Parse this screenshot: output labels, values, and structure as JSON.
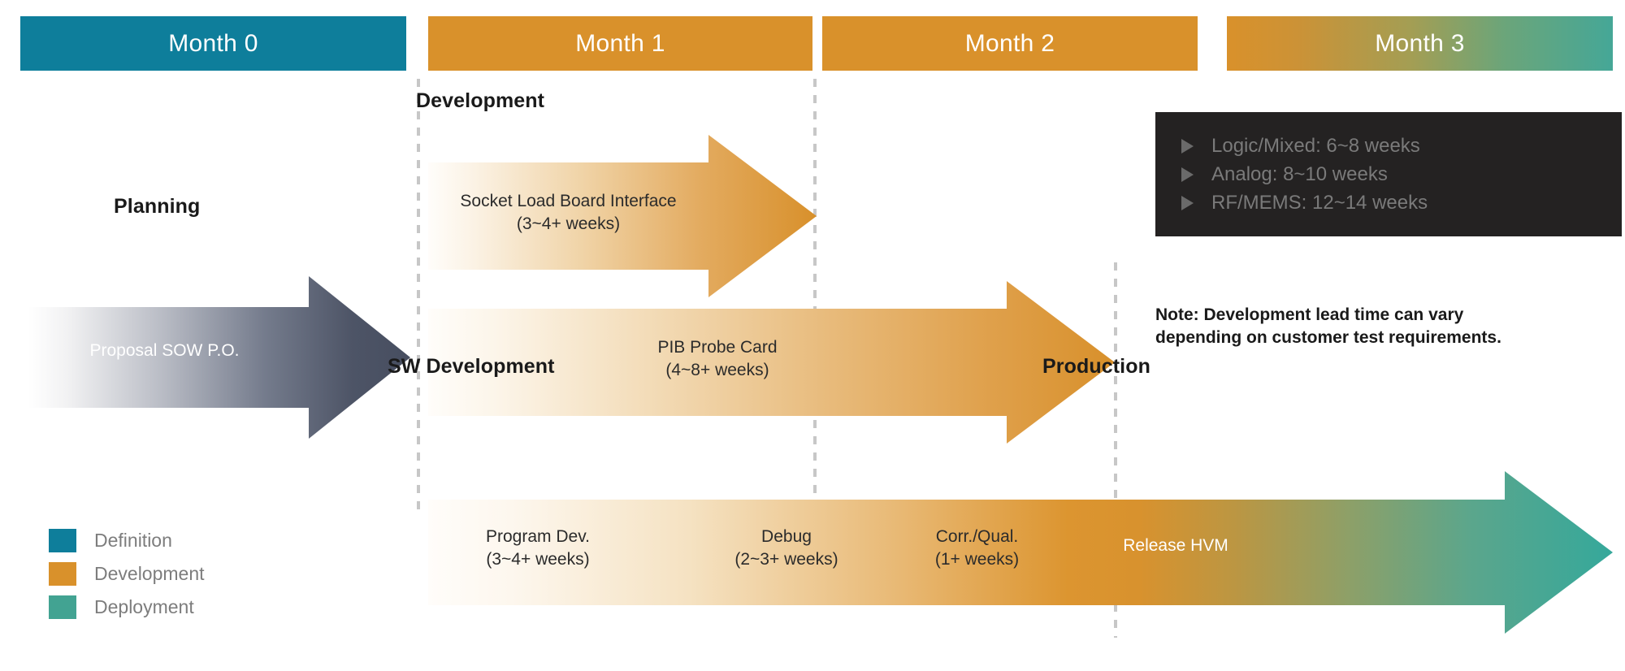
{
  "timeline": {
    "months": [
      {
        "label": "Month 0",
        "color": "#0E7E9B"
      },
      {
        "label": "Month 1",
        "color": "#D9912B"
      },
      {
        "label": "Month 2",
        "color": "#D9912B"
      },
      {
        "label": "Month 3",
        "color": "#D9912B"
      }
    ]
  },
  "phases": {
    "planning": "Planning",
    "development": "Development",
    "sw_development": "SW Development",
    "production": "Production"
  },
  "tracks": [
    {
      "name": "planning",
      "label": "Proposal SOW P.O.",
      "caption": "Planning"
    },
    {
      "name": "socket-load-board",
      "label": "Socket Load Board Interface\n(3~4+ weeks)",
      "caption": "Development"
    },
    {
      "name": "pib-probe-card",
      "label": "PIB Probe Card\n(4~8+ weeks)"
    },
    {
      "name": "sw-development",
      "caption": "SW Development",
      "segments": [
        {
          "label": "Program Dev.\n(3~4+ weeks)"
        },
        {
          "label": "Debug\n(2~3+ weeks)"
        },
        {
          "label": "Corr./Qual.\n(1+ weeks)"
        },
        {
          "label": "Release HVM"
        }
      ]
    }
  ],
  "lead_time": {
    "items": [
      "Logic/Mixed: 6~8 weeks",
      "Analog: 8~10 weeks",
      "RF/MEMS: 12~14 weeks"
    ],
    "icon": "triangle-right-icon"
  },
  "note": "Note: Development lead time can vary\ndepending on customer test requirements.",
  "legend": {
    "items": [
      {
        "label": "Definition",
        "color": "#0E7E9B"
      },
      {
        "label": "Development",
        "color": "#D9912B"
      },
      {
        "label": "Deployment",
        "color": "#42A392"
      }
    ]
  }
}
